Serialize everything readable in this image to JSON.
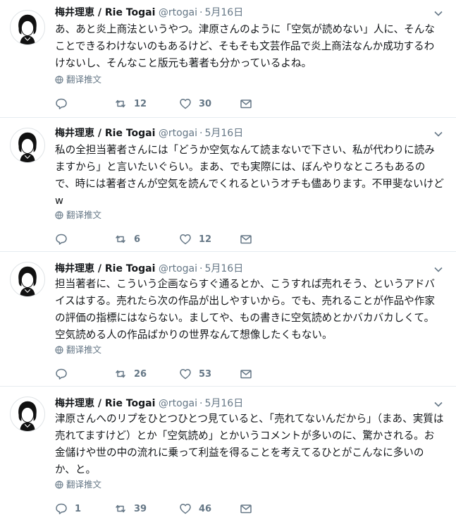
{
  "tweets": [
    {
      "name": "梅井理恵 / Rie Togai",
      "handle": "@rtogai",
      "date": "5月16日",
      "text": "あ、あと炎上商法というやつ。津原さんのように「空気が読めない」人に、そんなことできるわけないのもあるけど、そもそも文芸作品で炎上商法なんか成功するわけないし、そんなこと版元も著者も分かっているよね。",
      "translate": "翻译推文",
      "replies": "",
      "retweets": "12",
      "likes": "30"
    },
    {
      "name": "梅井理恵 / Rie Togai",
      "handle": "@rtogai",
      "date": "5月16日",
      "text": "私の全担当著者さんには「どうか空気なんて読まないで下さい、私が代わりに読みますから」と言いたいぐらい。まあ、でも実際には、ぼんやりなところもあるので、時には著者さんが空気を読んでくれるというオチも儘あります。不甲斐ないけどw",
      "translate": "翻译推文",
      "replies": "",
      "retweets": "6",
      "likes": "12"
    },
    {
      "name": "梅井理恵 / Rie Togai",
      "handle": "@rtogai",
      "date": "5月16日",
      "text": "担当著者に、こういう企画ならすぐ通るとか、こうすれば売れそう、というアドバイスはする。売れたら次の作品が出しやすいから。でも、売れることが作品や作家の評価の指標にはならない。ましてや、もの書きに空気読めとかバカバカしくて。空気読める人の作品ばかりの世界なんて想像したくもない。",
      "translate": "翻译推文",
      "replies": "",
      "retweets": "26",
      "likes": "53"
    },
    {
      "name": "梅井理恵 / Rie Togai",
      "handle": "@rtogai",
      "date": "5月16日",
      "text": "津原さんへのリプをひとつひとつ見ていると、「売れてないんだから」（まあ、実質は売れてますけど）とか「空気読め」とかいうコメントが多いのに、驚かされる。お金儲けや世の中の流れに乗って利益を得ることを考えてるひとがこんなに多いのか、と。",
      "translate": "翻译推文",
      "replies": "1",
      "retweets": "39",
      "likes": "46"
    }
  ]
}
